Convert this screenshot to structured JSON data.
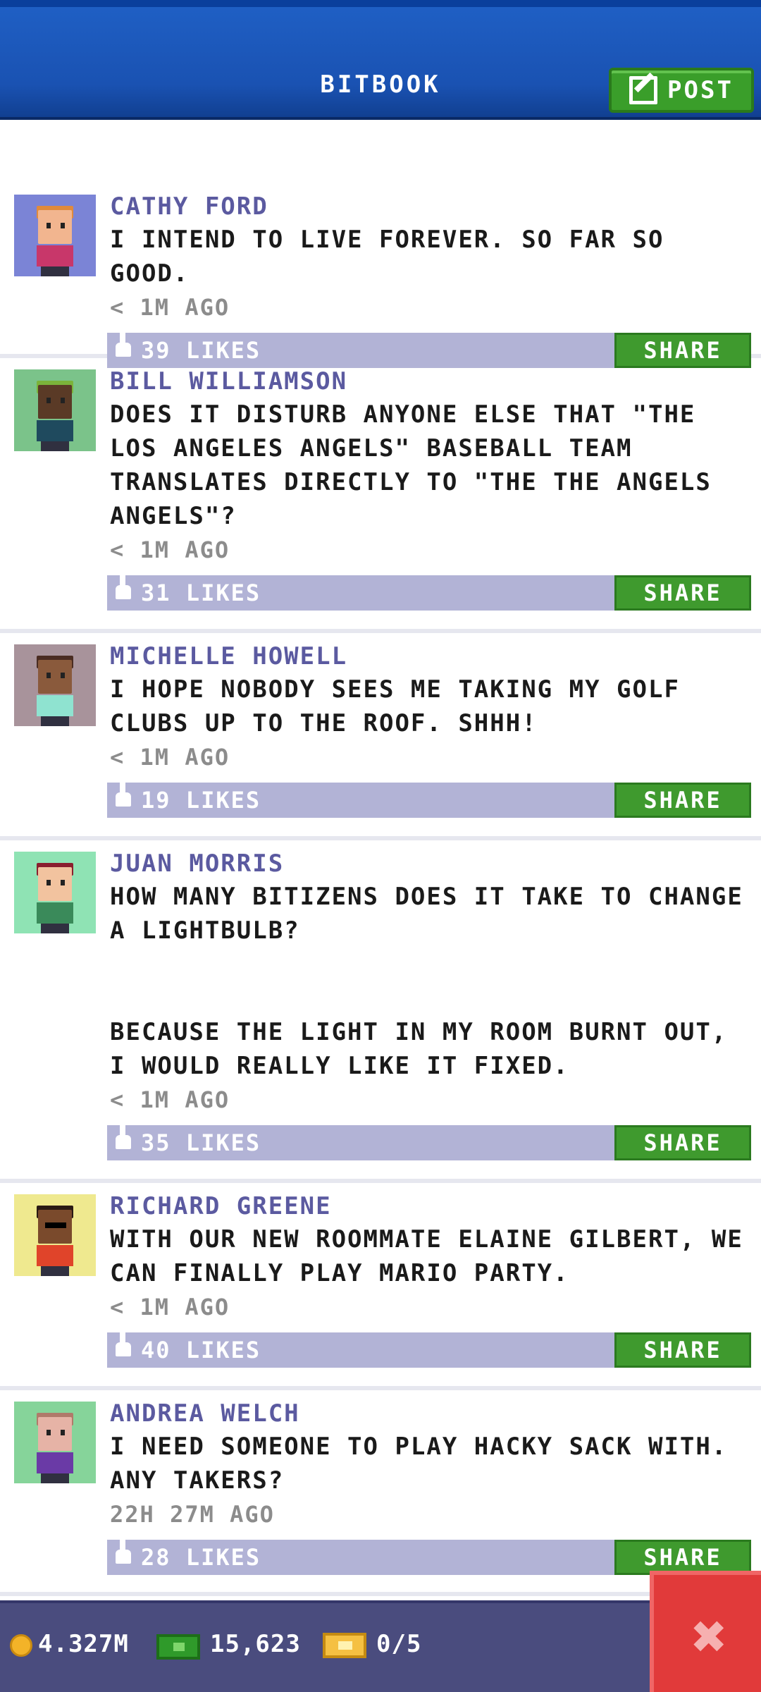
{
  "header": {
    "title": "BITBOOK",
    "post_label": "POST"
  },
  "posts": [
    {
      "author": "CATHY FORD",
      "message": "I INTEND TO LIVE FOREVER. SO FAR SO GOOD.",
      "time": "< 1M AGO",
      "likes": "39 LIKES",
      "share_label": "SHARE",
      "avatar_bg": "#7b84d6"
    },
    {
      "author": "BILL WILLIAMSON",
      "message": "DOES IT DISTURB ANYONE ELSE THAT \"THE LOS ANGELES ANGELS\" BASEBALL TEAM TRANSLATES DIRECTLY TO \"THE THE ANGELS ANGELS\"?",
      "time": "< 1M AGO",
      "likes": "31 LIKES",
      "share_label": "SHARE",
      "avatar_bg": "#7bc38a"
    },
    {
      "author": "MICHELLE HOWELL",
      "message": "I HOPE NOBODY SEES ME TAKING MY GOLF CLUBS UP TO THE ROOF. SHHH!",
      "time": "< 1M AGO",
      "likes": "19 LIKES",
      "share_label": "SHARE",
      "avatar_bg": "#a8939b"
    },
    {
      "author": "JUAN MORRIS",
      "message": "HOW MANY BITIZENS DOES IT TAKE TO CHANGE A LIGHTBULB?\n\n\nBECAUSE THE LIGHT IN MY ROOM BURNT OUT, I WOULD REALLY LIKE IT FIXED.",
      "time": "< 1M AGO",
      "likes": "35 LIKES",
      "share_label": "SHARE",
      "avatar_bg": "#8fe3b4"
    },
    {
      "author": "RICHARD GREENE",
      "message": "WITH OUR NEW ROOMMATE ELAINE GILBERT, WE CAN FINALLY PLAY MARIO PARTY.",
      "time": "< 1M AGO",
      "likes": "40 LIKES",
      "share_label": "SHARE",
      "avatar_bg": "#efe98f"
    },
    {
      "author": "ANDREA WELCH",
      "message": "I NEED SOMEONE TO PLAY HACKY SACK WITH. ANY TAKERS?",
      "time": "22H 27M AGO",
      "likes": "28 LIKES",
      "share_label": "SHARE",
      "avatar_bg": "#86d49a"
    }
  ],
  "bottom_bar": {
    "coins": "4.327M",
    "bux": "15,623",
    "tickets": "0/5"
  }
}
